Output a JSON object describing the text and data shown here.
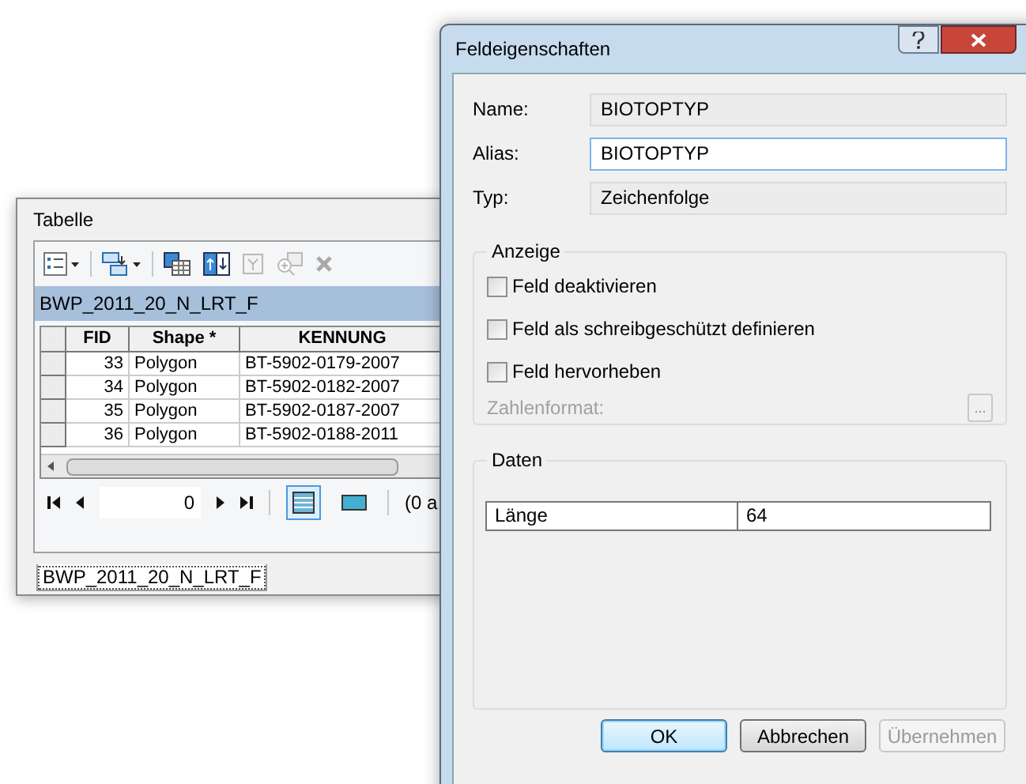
{
  "table_window": {
    "title": "Tabelle",
    "toolbar": [
      {
        "kind": "options",
        "disabled": false
      },
      {
        "kind": "related",
        "disabled": false
      },
      {
        "kind": "select-by",
        "disabled": false
      },
      {
        "kind": "switch",
        "disabled": false
      },
      {
        "kind": "clear",
        "disabled": true
      },
      {
        "kind": "zoom",
        "disabled": true
      },
      {
        "kind": "delete",
        "disabled": true
      }
    ],
    "layer": "BWP_2011_20_N_LRT_F",
    "columns": [
      "FID",
      "Shape *",
      "KENNUNG"
    ],
    "rows": [
      [
        "33",
        "Polygon",
        "BT-5902-0179-2007"
      ],
      [
        "34",
        "Polygon",
        "BT-5902-0182-2007"
      ],
      [
        "35",
        "Polygon",
        "BT-5902-0187-2007"
      ],
      [
        "36",
        "Polygon",
        "BT-5902-0188-2011"
      ]
    ],
    "record": "0",
    "views": [
      {
        "kind": "all",
        "selected": true
      },
      {
        "kind": "selected",
        "selected": false
      }
    ],
    "count": "(0 a",
    "tab": "BWP_2011_20_N_LRT_F"
  },
  "dialog": {
    "title": "Feldeigenschaften",
    "fields": [
      {
        "label": "Name:",
        "value": "BIOTOPTYP",
        "editable": false
      },
      {
        "label": "Alias:",
        "value": "BIOTOPTYP",
        "editable": true
      },
      {
        "label": "Typ:",
        "value": "Zeichenfolge",
        "editable": false
      }
    ],
    "display_group": "Anzeige",
    "checkboxes": [
      {
        "label": "Feld deaktivieren",
        "checked": false
      },
      {
        "label": "Feld als schreibgeschützt definieren",
        "checked": false
      },
      {
        "label": "Feld hervorheben",
        "checked": false
      }
    ],
    "number_format": {
      "label": "Zahlenformat:",
      "disabled": true,
      "button": "..."
    },
    "data_group": "Daten",
    "properties": [
      {
        "name": "Länge",
        "value": "64"
      }
    ],
    "buttons": [
      {
        "label": "OK",
        "default": true,
        "disabled": false
      },
      {
        "label": "Abbrechen",
        "default": false,
        "disabled": false
      },
      {
        "label": "Übernehmen",
        "default": false,
        "disabled": true
      }
    ]
  }
}
